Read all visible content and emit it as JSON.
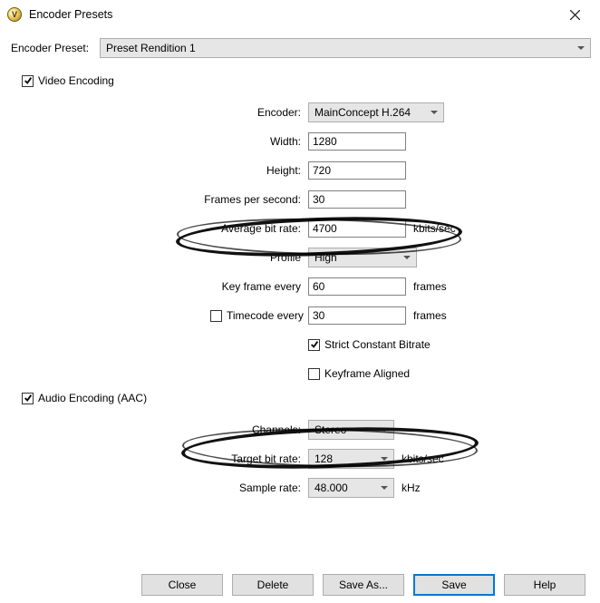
{
  "window": {
    "title": "Encoder Presets"
  },
  "presetRow": {
    "label": "Encoder Preset:",
    "value": "Preset Rendition 1"
  },
  "videoSection": {
    "checkbox_label": "Video Encoding",
    "checked": true,
    "encoder": {
      "label": "Encoder:",
      "value": "MainConcept H.264"
    },
    "width": {
      "label": "Width:",
      "value": "1280"
    },
    "height": {
      "label": "Height:",
      "value": "720"
    },
    "fps": {
      "label": "Frames per second:",
      "value": "30"
    },
    "avg_bitrate": {
      "label": "Average bit rate:",
      "value": "4700",
      "unit": "kbits/sec"
    },
    "profile": {
      "label": "Profile",
      "value": "High"
    },
    "keyframe_every": {
      "label": "Key frame every",
      "value": "60",
      "unit": "frames"
    },
    "timecode_every": {
      "label": "Timecode every",
      "value": "30",
      "unit": "frames",
      "checked": false
    },
    "strict_cbr": {
      "label": "Strict Constant Bitrate",
      "checked": true
    },
    "keyframe_aligned": {
      "label": "Keyframe Aligned",
      "checked": false
    }
  },
  "audioSection": {
    "checkbox_label": "Audio Encoding (AAC)",
    "checked": true,
    "channels": {
      "label": "Channels:",
      "value": "Stereo"
    },
    "target_bitrate": {
      "label": "Target bit rate:",
      "value": "128",
      "unit": "kbits/sec"
    },
    "sample_rate": {
      "label": "Sample rate:",
      "value": "48.000",
      "unit": "kHz"
    }
  },
  "buttons": {
    "close": "Close",
    "delete": "Delete",
    "save_as": "Save As...",
    "save": "Save",
    "help": "Help"
  }
}
